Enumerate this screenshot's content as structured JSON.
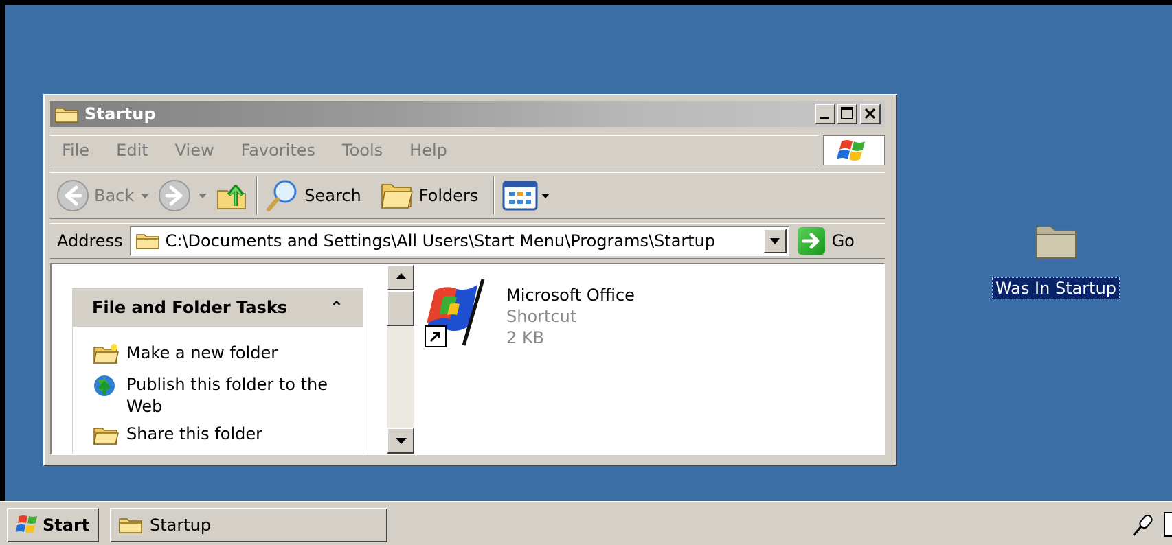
{
  "window": {
    "title": "Startup",
    "controls": {
      "minimize": "_",
      "maximize": "□",
      "close": "×"
    }
  },
  "menu": [
    "File",
    "Edit",
    "View",
    "Favorites",
    "Tools",
    "Help"
  ],
  "toolbar": {
    "back_label": "Back",
    "search_label": "Search",
    "folders_label": "Folders"
  },
  "address": {
    "label": "Address",
    "value": "C:\\Documents and Settings\\All Users\\Start Menu\\Programs\\Startup",
    "go_label": "Go"
  },
  "tasks": {
    "title": "File and Folder Tasks",
    "collapse_glyph": "⌃",
    "items": [
      {
        "label": "Make a new folder",
        "icon": "new-folder-icon"
      },
      {
        "label": "Publish this folder to the Web",
        "icon": "publish-web-icon"
      },
      {
        "label": "Share this folder",
        "icon": "share-folder-icon"
      }
    ]
  },
  "files": [
    {
      "name": "Microsoft Office",
      "type": "Shortcut",
      "size": "2 KB",
      "icon": "office-shortcut-icon"
    }
  ],
  "desktop_icons": [
    {
      "label": "Was In Startup",
      "icon": "folder-icon"
    }
  ],
  "taskbar": {
    "start_label": "Start",
    "task_label": "Startup"
  },
  "colors": {
    "desktop": "#3a6ea5",
    "window_face": "#d4d0c8",
    "selection": "#0a246a"
  }
}
